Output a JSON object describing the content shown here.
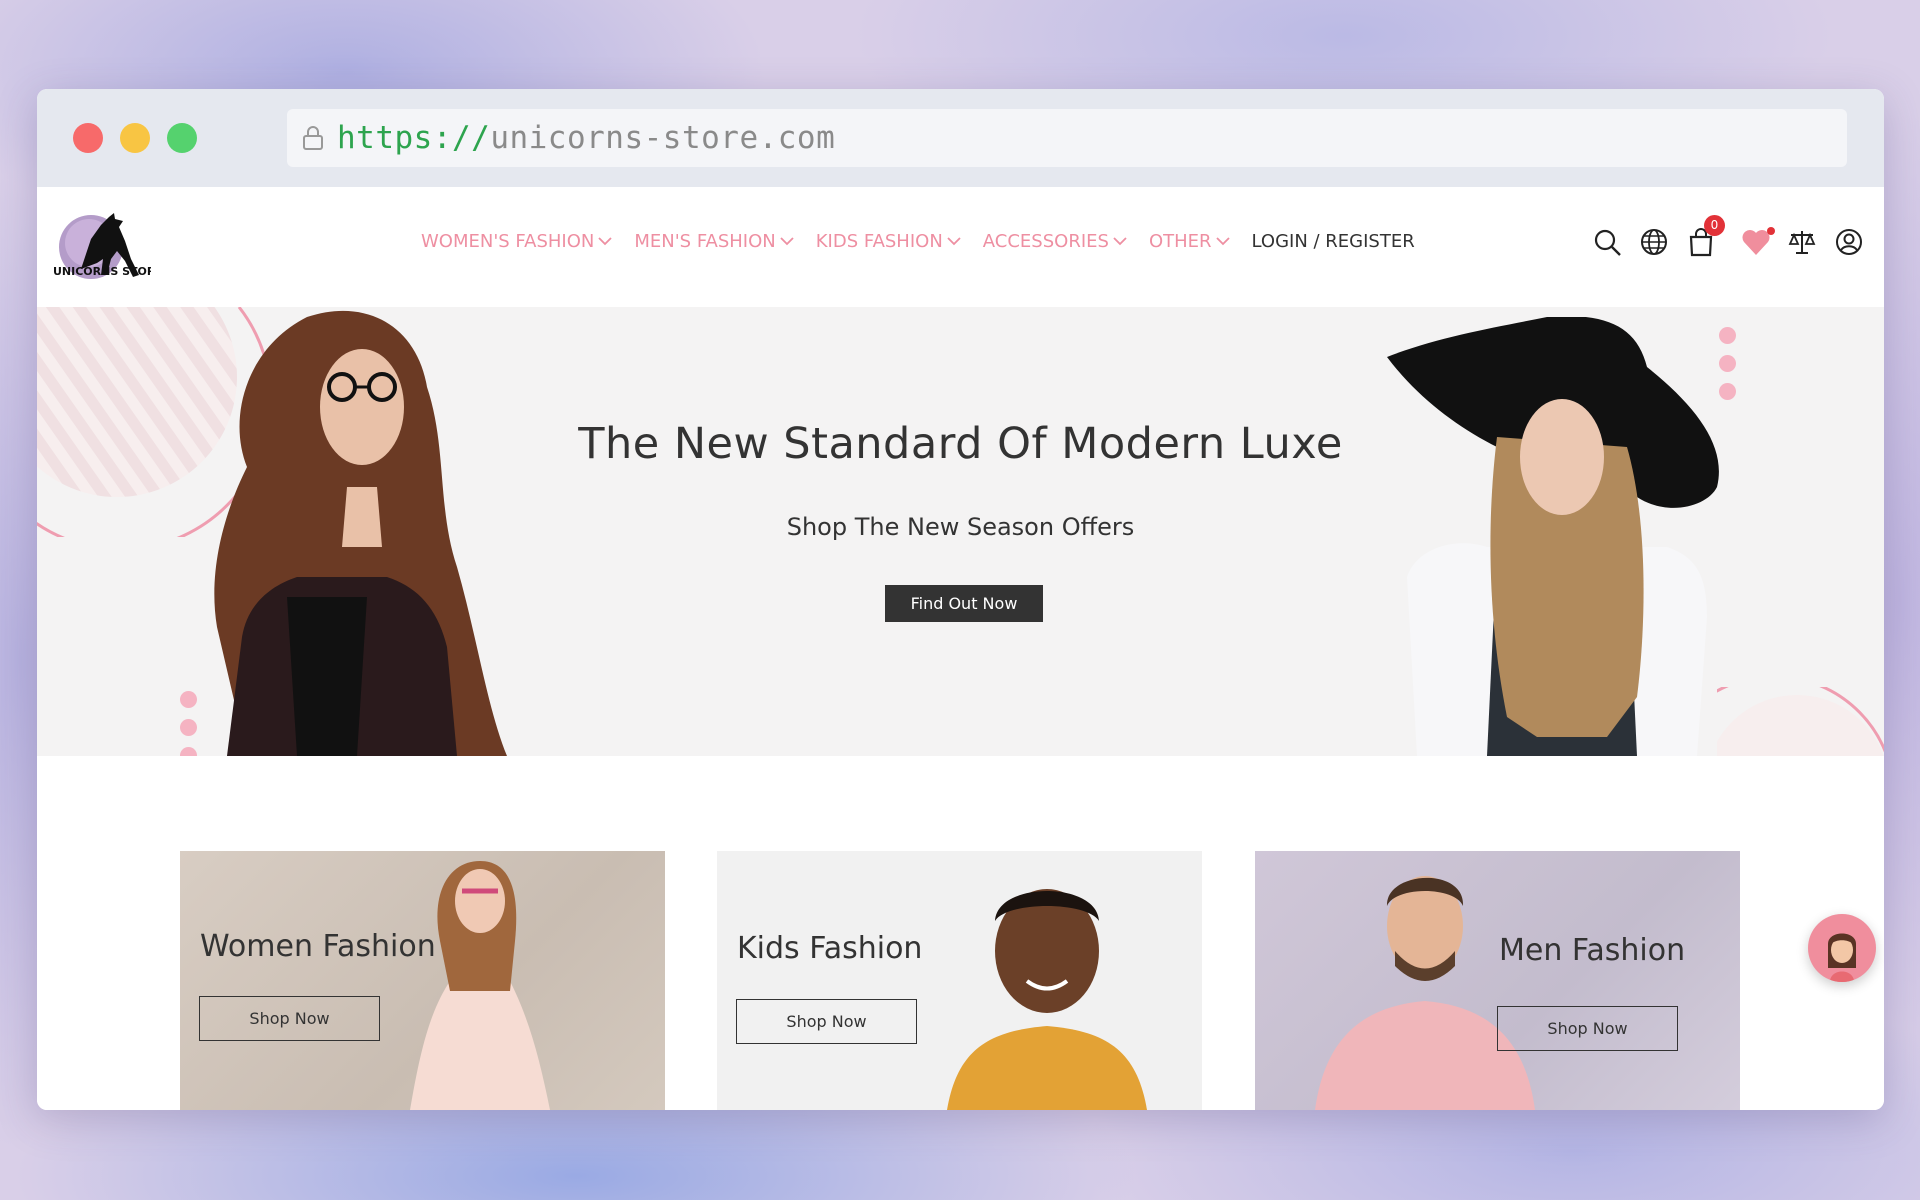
{
  "browser": {
    "url_protocol": "https://",
    "url_host": "unicorns-store.com"
  },
  "header": {
    "logo_alt": "Unicorns Store",
    "nav": [
      {
        "label": "WOMEN'S FASHION",
        "has_dropdown": true
      },
      {
        "label": "MEN'S FASHION",
        "has_dropdown": true
      },
      {
        "label": "KIDS FASHION",
        "has_dropdown": true
      },
      {
        "label": "ACCESSORIES",
        "has_dropdown": true
      },
      {
        "label": "OTHER",
        "has_dropdown": true
      }
    ],
    "login_label": "LOGIN / REGISTER",
    "icons": [
      "search-icon",
      "globe-icon",
      "cart-icon",
      "heart-icon",
      "compare-icon",
      "user-icon"
    ],
    "cart_count": "0"
  },
  "hero": {
    "title": "The New Standard Of Modern Luxe",
    "subtitle": "Shop The New Season Offers",
    "button_label": "Find Out Now"
  },
  "categories": [
    {
      "title": "Women Fashion",
      "button_label": "Shop Now"
    },
    {
      "title": "Kids Fashion",
      "button_label": "Shop Now"
    },
    {
      "title": "Men Fashion",
      "button_label": "Shop Now"
    }
  ],
  "colors": {
    "accent_pink": "#ee8fa2",
    "dark": "#333333",
    "badge_red": "#e23238",
    "hero_bg": "#f4f3f3"
  }
}
